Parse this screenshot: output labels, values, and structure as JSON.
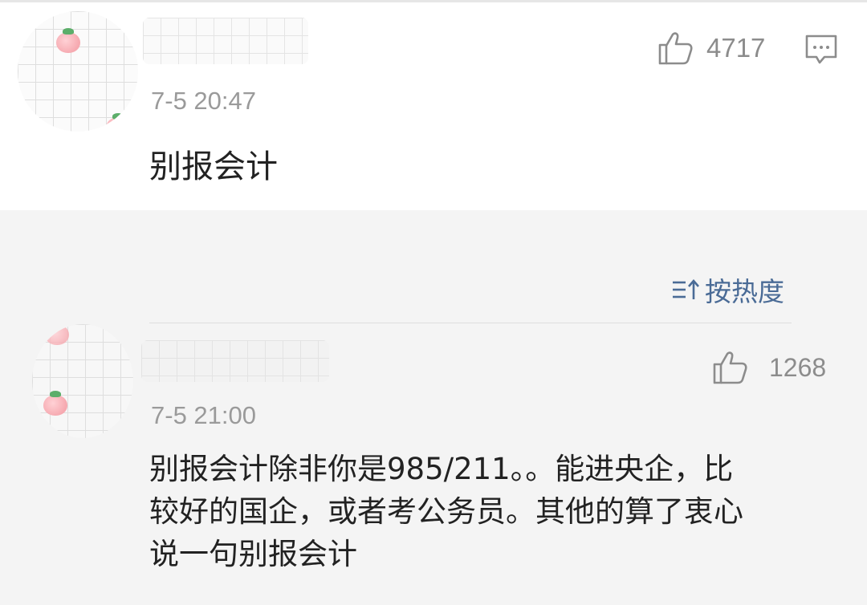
{
  "top_comment": {
    "time": "7-5 20:47",
    "text": "别报会计",
    "like_count": "4717"
  },
  "sort": {
    "label": "按热度"
  },
  "reply": {
    "time": "7-5 21:00",
    "text": "别报会计除非你是985/211。。能进央企，比\n较好的国企，或者考公务员。其他的算了衷心\n说一句别报会计",
    "like_count": "1268"
  },
  "colors": {
    "accent": "#4a6b96",
    "meta_gray": "#9a9a9a",
    "text": "#222222",
    "background": "#f4f4f4"
  },
  "icons": {
    "like": "thumbs-up-icon",
    "reply": "comment-icon",
    "sort": "sort-icon"
  }
}
